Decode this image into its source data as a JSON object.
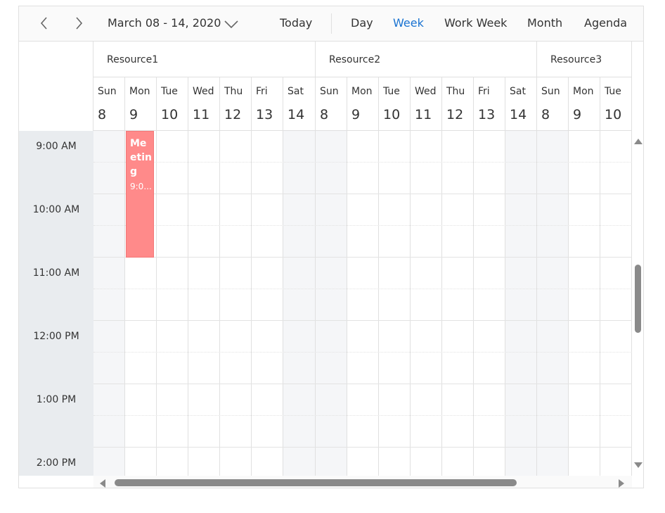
{
  "toolbar": {
    "prev_icon": "chevron-left-icon",
    "next_icon": "chevron-right-icon",
    "date_range": "March 08 - 14, 2020",
    "date_dropdown_icon": "chevron-down-icon",
    "today_label": "Today",
    "views": [
      {
        "label": "Day",
        "active": false
      },
      {
        "label": "Week",
        "active": true
      },
      {
        "label": "Work Week",
        "active": false
      },
      {
        "label": "Month",
        "active": false
      },
      {
        "label": "Agenda",
        "active": false
      }
    ],
    "active_color": "#1a73d1"
  },
  "resources": [
    {
      "name": "Resource1"
    },
    {
      "name": "Resource2"
    },
    {
      "name": "Resource3"
    }
  ],
  "days": [
    {
      "name": "Sun",
      "num": "8"
    },
    {
      "name": "Mon",
      "num": "9"
    },
    {
      "name": "Tue",
      "num": "10"
    },
    {
      "name": "Wed",
      "num": "11"
    },
    {
      "name": "Thu",
      "num": "12"
    },
    {
      "name": "Fri",
      "num": "13"
    },
    {
      "name": "Sat",
      "num": "14"
    },
    {
      "name": "Sun",
      "num": "8"
    },
    {
      "name": "Mon",
      "num": "9"
    },
    {
      "name": "Tue",
      "num": "10"
    },
    {
      "name": "Wed",
      "num": "11"
    },
    {
      "name": "Thu",
      "num": "12"
    },
    {
      "name": "Fri",
      "num": "13"
    },
    {
      "name": "Sat",
      "num": "14"
    },
    {
      "name": "Sun",
      "num": "8"
    },
    {
      "name": "Mon",
      "num": "9"
    },
    {
      "name": "Tue",
      "num": "10"
    }
  ],
  "time_slots": [
    "9:00 AM",
    "10:00 AM",
    "11:00 AM",
    "12:00 PM",
    "1:00 PM",
    "2:00 PM"
  ],
  "appointment": {
    "subject": "Meeting",
    "time": "9:0...",
    "color": "#ff8a8a"
  },
  "scrollbars": {
    "up_icon": "triangle-up-icon",
    "down_icon": "triangle-down-icon",
    "left_icon": "triangle-left-icon",
    "right_icon": "triangle-right-icon"
  }
}
